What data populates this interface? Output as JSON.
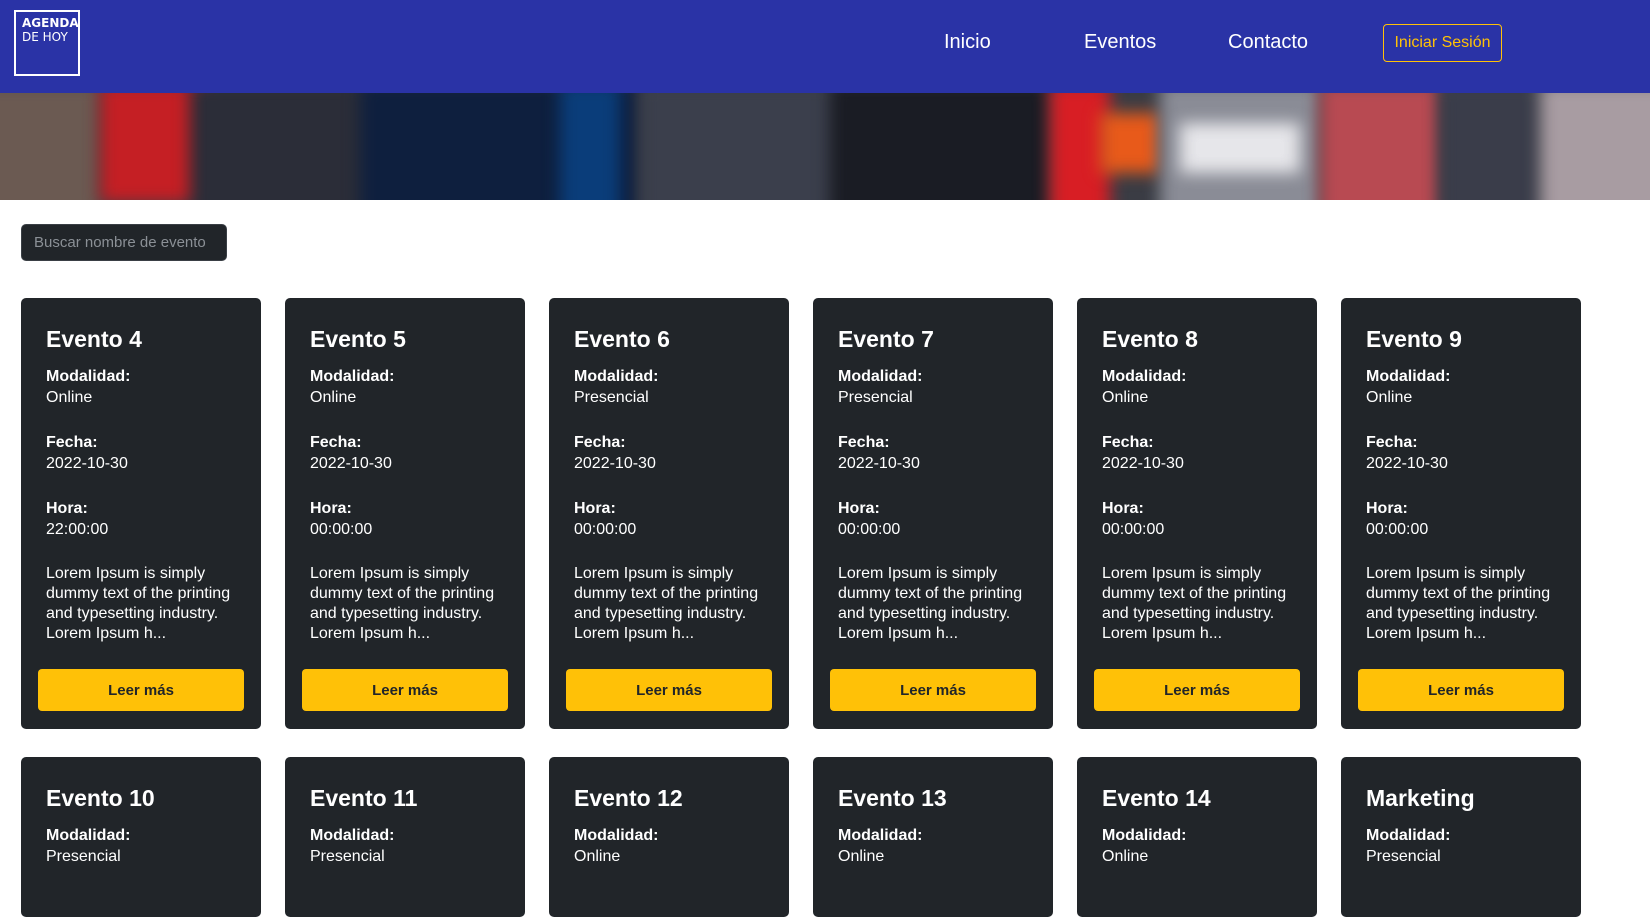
{
  "header": {
    "logo_line1": "AGENDA",
    "logo_line2": "DE HOY",
    "nav": [
      "Inicio",
      "Eventos",
      "Contacto"
    ],
    "login_label": "Iniciar Sesión",
    "colors": {
      "navbar": "#2a33a6",
      "accent": "#ffc107"
    }
  },
  "search": {
    "placeholder": "Buscar nombre de evento",
    "value": ""
  },
  "labels": {
    "modalidad": "Modalidad:",
    "fecha": "Fecha:",
    "hora": "Hora:",
    "read_more": "Leer más"
  },
  "events": [
    {
      "title": "Evento 4",
      "modalidad": "Online",
      "fecha": "2022-10-30",
      "hora": "22:00:00",
      "desc": "Lorem Ipsum is simply dummy text of the printing and typesetting industry. Lorem Ipsum h..."
    },
    {
      "title": "Evento 5",
      "modalidad": "Online",
      "fecha": "2022-10-30",
      "hora": "00:00:00",
      "desc": "Lorem Ipsum is simply dummy text of the printing and typesetting industry. Lorem Ipsum h..."
    },
    {
      "title": "Evento 6",
      "modalidad": "Presencial",
      "fecha": "2022-10-30",
      "hora": "00:00:00",
      "desc": "Lorem Ipsum is simply dummy text of the printing and typesetting industry. Lorem Ipsum h..."
    },
    {
      "title": "Evento 7",
      "modalidad": "Presencial",
      "fecha": "2022-10-30",
      "hora": "00:00:00",
      "desc": "Lorem Ipsum is simply dummy text of the printing and typesetting industry. Lorem Ipsum h..."
    },
    {
      "title": "Evento 8",
      "modalidad": "Online",
      "fecha": "2022-10-30",
      "hora": "00:00:00",
      "desc": "Lorem Ipsum is simply dummy text of the printing and typesetting industry. Lorem Ipsum h..."
    },
    {
      "title": "Evento 9",
      "modalidad": "Online",
      "fecha": "2022-10-30",
      "hora": "00:00:00",
      "desc": "Lorem Ipsum is simply dummy text of the printing and typesetting industry. Lorem Ipsum h..."
    },
    {
      "title": "Evento 10",
      "modalidad": "Presencial"
    },
    {
      "title": "Evento 11",
      "modalidad": "Presencial"
    },
    {
      "title": "Evento 12",
      "modalidad": "Online"
    },
    {
      "title": "Evento 13",
      "modalidad": "Online"
    },
    {
      "title": "Evento 14",
      "modalidad": "Online"
    },
    {
      "title": "Marketing",
      "modalidad": "Presencial"
    }
  ]
}
